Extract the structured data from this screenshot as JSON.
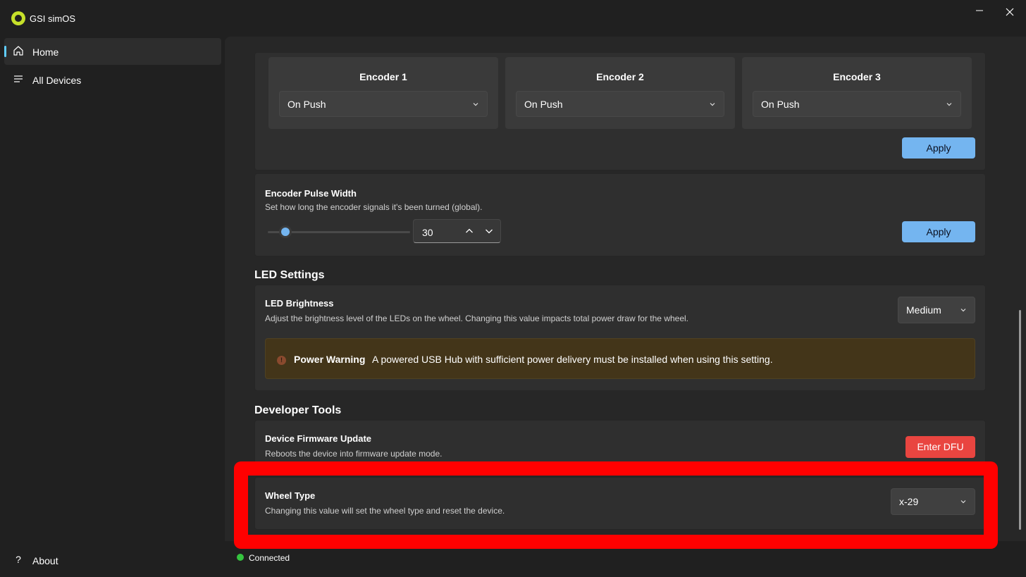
{
  "app": {
    "title": "GSI simOS",
    "minimize_icon": "minimize-icon",
    "close_icon": "close-icon"
  },
  "sidebar": {
    "items": [
      {
        "label": "Home",
        "icon": "home-icon",
        "active": true
      },
      {
        "label": "All Devices",
        "icon": "list-icon",
        "active": false
      }
    ],
    "footer": {
      "label": "About",
      "icon": "question-icon"
    }
  },
  "encoders": {
    "items": [
      {
        "title": "Encoder 1",
        "mode": "On Push"
      },
      {
        "title": "Encoder 2",
        "mode": "On Push"
      },
      {
        "title": "Encoder 3",
        "mode": "On Push"
      }
    ],
    "apply_label": "Apply"
  },
  "pulse_width": {
    "title": "Encoder Pulse Width",
    "description": "Set how long the encoder signals it's been turned (global).",
    "value": "30",
    "apply_label": "Apply"
  },
  "led_settings": {
    "section_title": "LED Settings",
    "brightness_title": "LED Brightness",
    "brightness_desc": "Adjust the brightness level of the LEDs on the wheel. Changing this value impacts total power draw for the wheel.",
    "brightness_value": "Medium",
    "warning_title": "Power Warning",
    "warning_text": "A powered USB Hub with sufficient power delivery must be installed when using this setting.",
    "warning_icon": "exclamation-icon"
  },
  "developer_tools": {
    "section_title": "Developer Tools",
    "dfu_title": "Device Firmware Update",
    "dfu_desc": "Reboots the device into firmware update mode.",
    "dfu_button": "Enter DFU",
    "wheel_title": "Wheel Type",
    "wheel_desc": "Changing this value will set the wheel type and reset the device.",
    "wheel_value": "x-29"
  },
  "status": {
    "text": "Connected",
    "color": "#35c43f"
  },
  "colors": {
    "accent": "#74b5f0",
    "danger": "#e94540",
    "highlight": "#ff0000",
    "warning_bg": "#433519"
  }
}
